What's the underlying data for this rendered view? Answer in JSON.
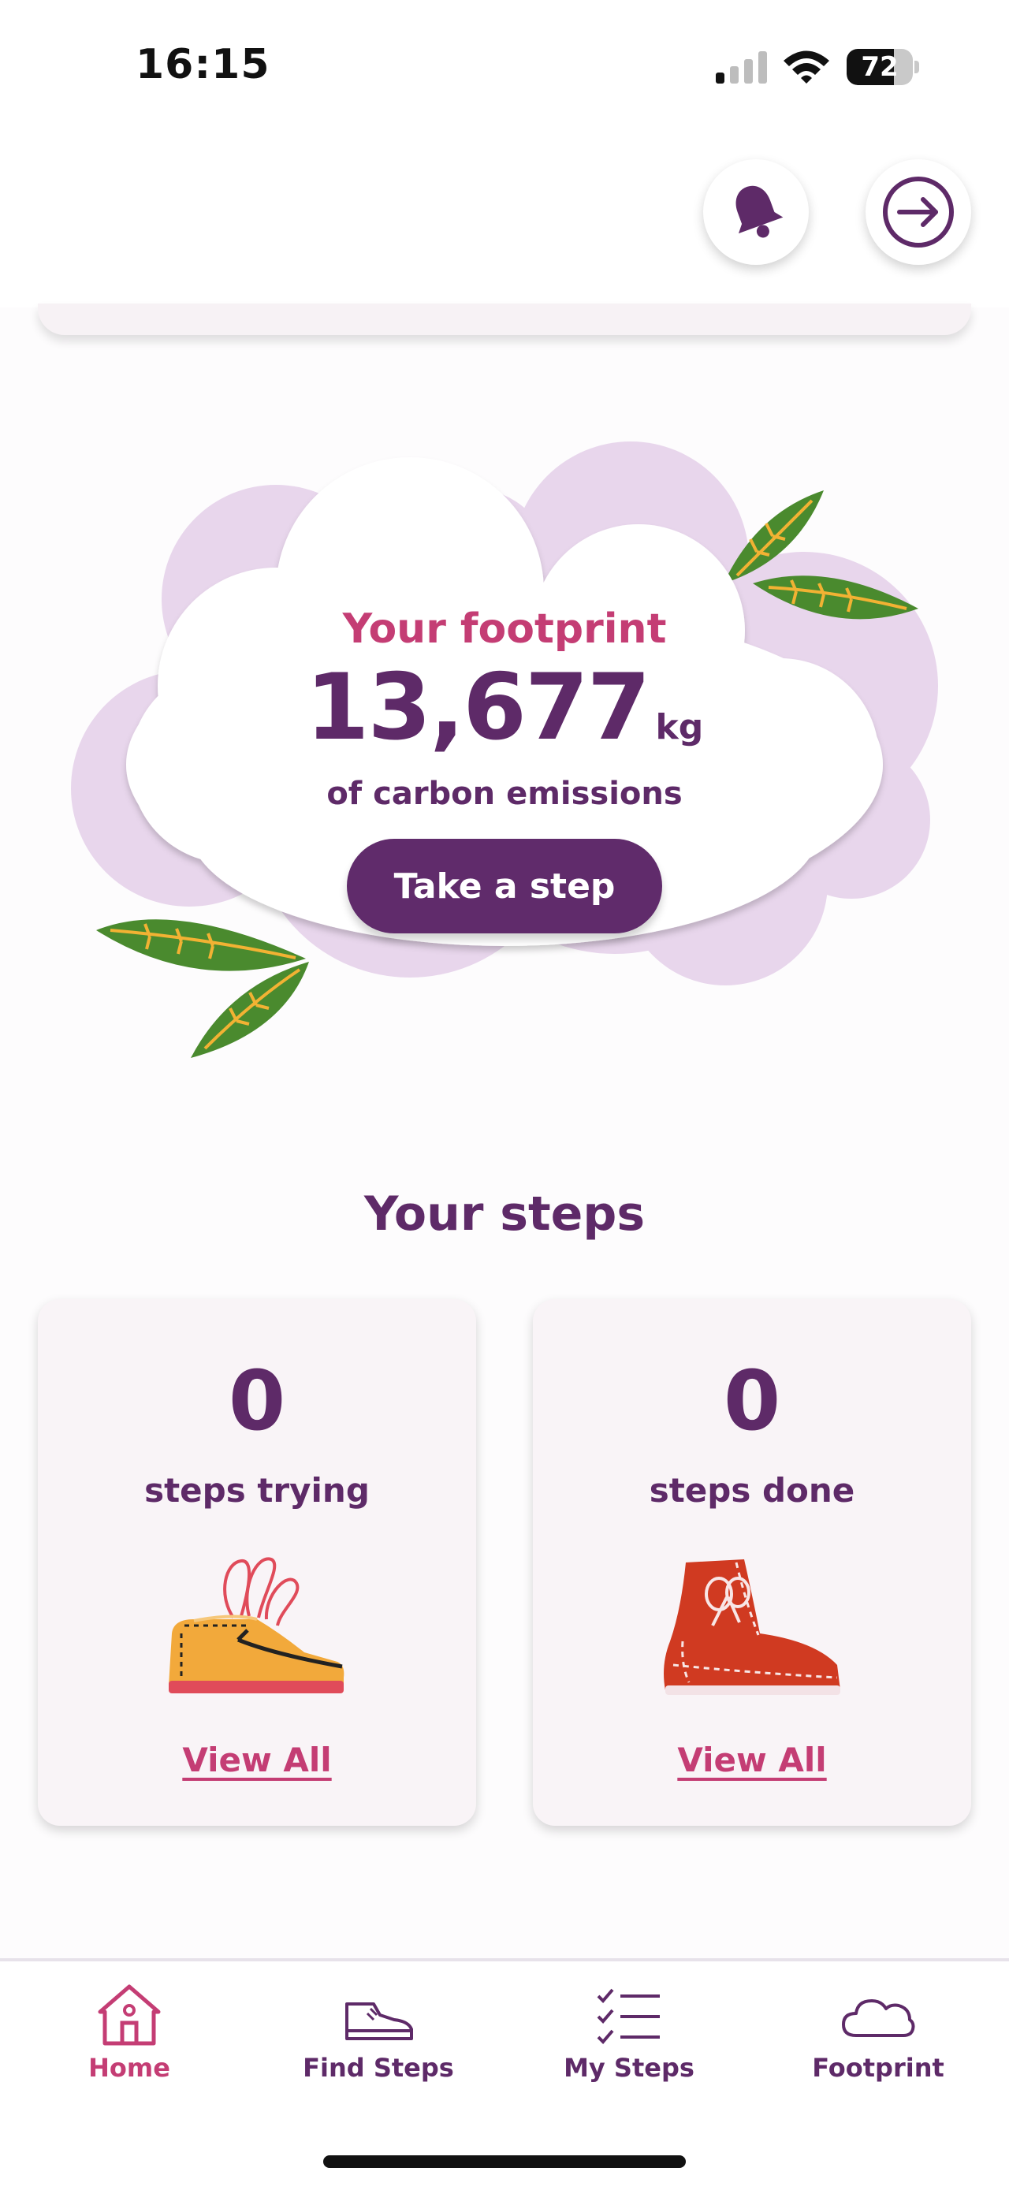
{
  "status_bar": {
    "time": "16:15",
    "battery": "72",
    "battery_level": 0.72
  },
  "header": {
    "bell_icon": "bell-icon",
    "logout_icon": "sign-out-icon"
  },
  "hero": {
    "title": "Your footprint",
    "value": "13,677",
    "unit": "kg",
    "subtitle": "of carbon emissions",
    "button_label": "Take a step"
  },
  "steps": {
    "title": "Your steps",
    "cards": [
      {
        "count": "0",
        "label": "steps trying",
        "link": "View All",
        "icon": "sneaker-icon"
      },
      {
        "count": "0",
        "label": "steps done",
        "link": "View All",
        "icon": "boot-icon"
      }
    ]
  },
  "nav": {
    "items": [
      {
        "label": "Home",
        "icon": "home-icon",
        "active": true
      },
      {
        "label": "Find Steps",
        "icon": "shoe-icon",
        "active": false
      },
      {
        "label": "My Steps",
        "icon": "checklist-icon",
        "active": false
      },
      {
        "label": "Footprint",
        "icon": "cloud-icon",
        "active": false
      }
    ]
  },
  "colors": {
    "primary": "#602b6b",
    "accent": "#c43d74",
    "cloud_back": "#e8d6ec",
    "leaf": "#4a8a2e"
  }
}
